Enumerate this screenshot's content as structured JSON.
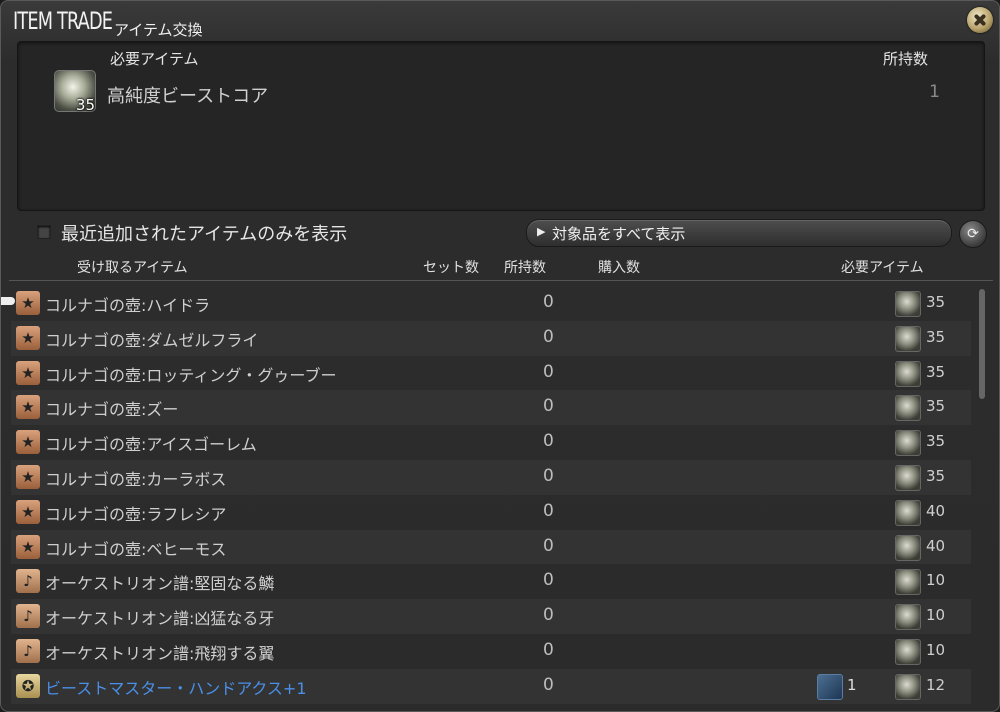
{
  "window": {
    "title": "ITEM TRADE",
    "subtitle": "アイテム交換"
  },
  "required_panel": {
    "header_item": "必要アイテム",
    "header_owned": "所持数",
    "item_name": "高純度ビーストコア",
    "item_qty": "35",
    "owned": "1"
  },
  "filter": {
    "label": "最近追加されたアイテムのみを表示",
    "checked": false
  },
  "show_all_button": {
    "label": "対象品をすべて表示"
  },
  "columns": {
    "receive": "受け取るアイテム",
    "set_count": "セット数",
    "owned": "所持数",
    "purchase": "購入数",
    "required": "必要アイテム"
  },
  "rows": [
    {
      "name": "コルナゴの壺:ハイドラ",
      "icon": "star-icon",
      "owned": "0",
      "cost": "35"
    },
    {
      "name": "コルナゴの壺:ダムゼルフライ",
      "icon": "star-icon",
      "owned": "0",
      "cost": "35"
    },
    {
      "name": "コルナゴの壺:ロッティング・グゥーブー",
      "icon": "star-icon",
      "owned": "0",
      "cost": "35"
    },
    {
      "name": "コルナゴの壺:ズー",
      "icon": "star-icon",
      "owned": "0",
      "cost": "35"
    },
    {
      "name": "コルナゴの壺:アイスゴーレム",
      "icon": "star-icon",
      "owned": "0",
      "cost": "35"
    },
    {
      "name": "コルナゴの壺:カーラボス",
      "icon": "star-icon",
      "owned": "0",
      "cost": "35"
    },
    {
      "name": "コルナゴの壺:ラフレシア",
      "icon": "star-icon",
      "owned": "0",
      "cost": "40"
    },
    {
      "name": "コルナゴの壺:ベヒーモス",
      "icon": "star-icon",
      "owned": "0",
      "cost": "40"
    },
    {
      "name": "オーケストリオン譜:堅固なる鱗",
      "icon": "music-note-icon",
      "owned": "0",
      "cost": "10"
    },
    {
      "name": "オーケストリオン譜:凶猛なる牙",
      "icon": "music-note-icon",
      "owned": "0",
      "cost": "10"
    },
    {
      "name": "オーケストリオン譜:飛翔する翼",
      "icon": "music-note-icon",
      "owned": "0",
      "cost": "10"
    },
    {
      "name": "ビーストマスター・ハンドアクス+1",
      "icon": "gear-emblem-icon",
      "owned": "0",
      "cost": "12",
      "extra_item_count": "1",
      "highlight_color": "#4a8fe8"
    }
  ]
}
